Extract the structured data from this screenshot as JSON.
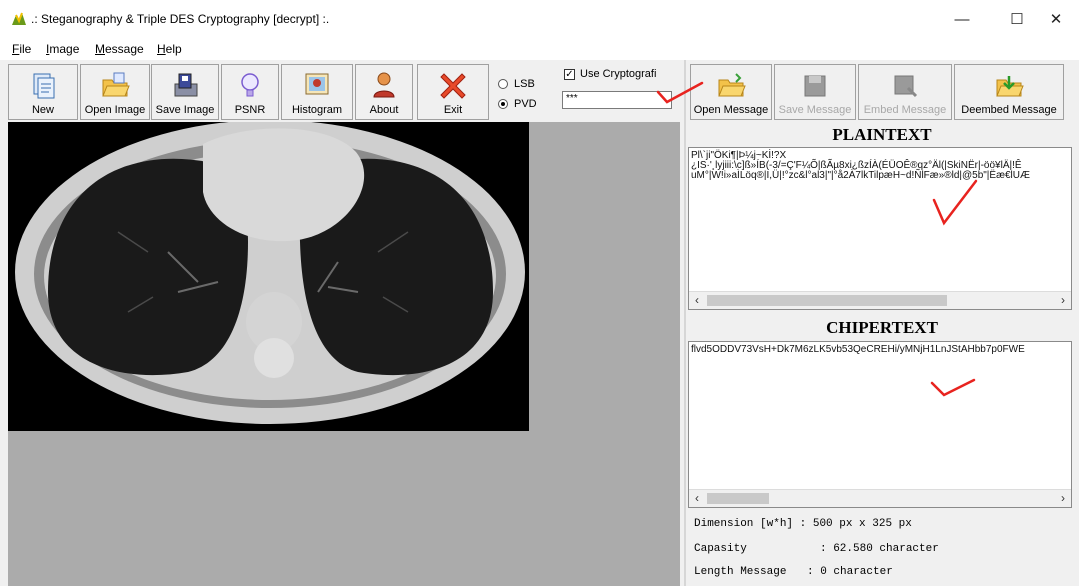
{
  "window": {
    "title": ".: Steganography & Triple DES Cryptography [decrypt] :.",
    "minimize_glyph": "—",
    "maximize_glyph": "☐",
    "close_glyph": "✕"
  },
  "menu": [
    {
      "label": "File",
      "underline": "F",
      "rest": "ile"
    },
    {
      "label": "Image",
      "underline": "I",
      "rest": "mage"
    },
    {
      "label": "Message",
      "underline": "M",
      "rest": "essage"
    },
    {
      "label": "Help",
      "underline": "H",
      "rest": "elp"
    }
  ],
  "toolbar_left": {
    "new_label": "New",
    "open_image_label": "Open Image",
    "save_image_label": "Save Image",
    "psnr_label": "PSNR",
    "histogram_label": "Histogram",
    "about_label": "About",
    "exit_label": "Exit"
  },
  "method": {
    "lsb_label": "LSB",
    "pvd_label": "PVD",
    "selected": "PVD"
  },
  "cryptography": {
    "checkbox_label": "Use Cryptografi",
    "checked": true,
    "password_value": "***"
  },
  "toolbar_right": {
    "open_message_label": "Open Message",
    "save_message_label": "Save Message",
    "embed_message_label": "Embed Message",
    "deembed_message_label": "Deembed Message"
  },
  "plaintext": {
    "header": "PLAINTEXT",
    "line1": "Pl\\`ji\"ÖKi¶|Þ¼j~Kİ!?X",
    "line2": "¿IS·'¸lyjiii:\\c]ß»ÍB(-3/=Ç'F¼Õ|ßÃµ8xi¿ßzÍÀ(ÉÜOÊ®qz°Äl(|SkiNËr|-öö¥lÄ|!Ê",
    "line3": "uM°|W!i»aÌLöq®|I,Ü|!°zc&l°al3|\"|°å2À7lkTilpæH~d!ÑlFæ»®ld|@5b\"|Ëæ€lUÆ"
  },
  "ciphertext": {
    "header": "CHIPERTEXT",
    "line1": "flvd5ODDV73VsH+Dk7M6zLK5vb53QeCREHi/yMNjH1LnJStAHbb7p0FWE"
  },
  "info": {
    "dimension_label": "Dimension [w*h]",
    "dimension_value": ": 500 px x 325 px",
    "capacity_label": "Capasity",
    "capacity_value": ": 62.580 character",
    "length_label": "Length Message",
    "length_value": ": 0 character"
  },
  "colors": {
    "annotation_red": "#e8231f",
    "window_bg": "#f0f0f0",
    "image_area_bg": "#ababab"
  }
}
